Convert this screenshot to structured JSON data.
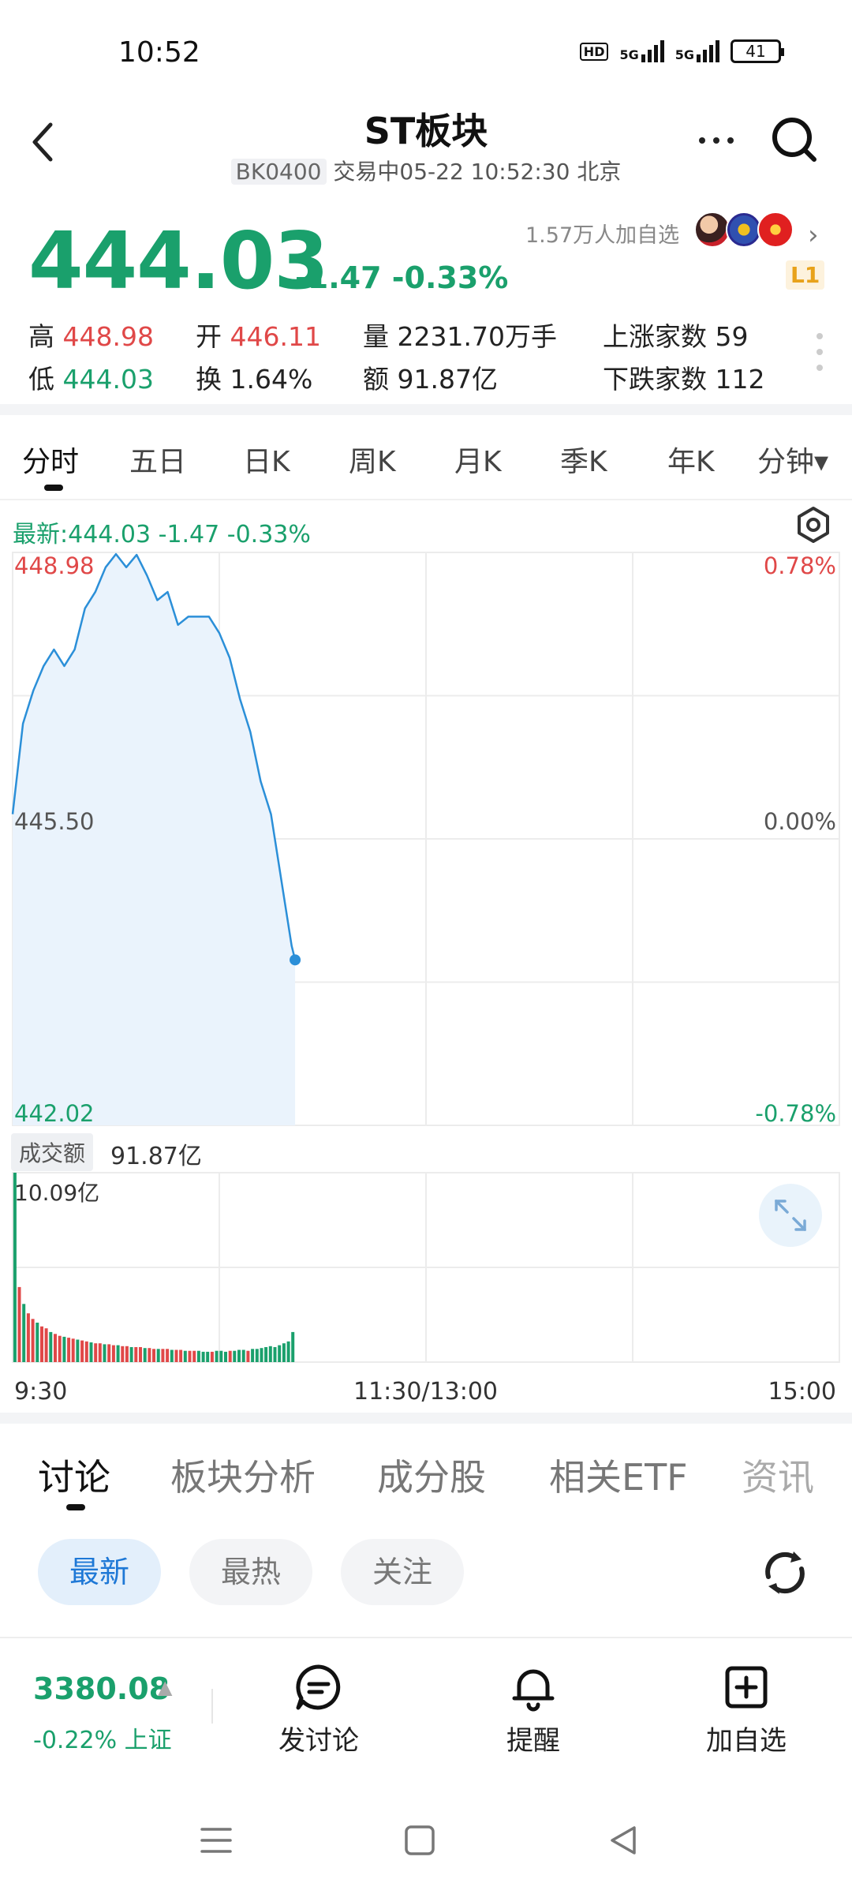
{
  "status": {
    "time": "10:52",
    "battery": "41",
    "hd": "HD",
    "net1": "5G",
    "net2": "5G"
  },
  "header": {
    "title": "ST板块",
    "code": "BK0400",
    "status_text": "交易中05-22 10:52:30 北京"
  },
  "quote": {
    "price": "444.03",
    "change": "-1.47 -0.33%",
    "followers": "1.57万人加自选",
    "level_badge": "L1",
    "stats": {
      "high_label": "高",
      "high": "448.98",
      "open_label": "开",
      "open": "446.11",
      "volume_label": "量",
      "volume": "2231.70万手",
      "up_label": "上涨家数",
      "up": "59",
      "low_label": "低",
      "low": "444.03",
      "turnover_label": "换",
      "turnover": "1.64%",
      "amount_label": "额",
      "amount": "91.87亿",
      "down_label": "下跌家数",
      "down": "112"
    }
  },
  "period_tabs": [
    "分时",
    "五日",
    "日K",
    "周K",
    "月K",
    "季K",
    "年K",
    "分钟▾"
  ],
  "chart": {
    "latest_line": "最新:444.03  -1.47  -0.33%",
    "top_price": "448.98",
    "mid_price": "445.50",
    "bottom_price": "442.02",
    "top_pct": "0.78%",
    "mid_pct": "0.00%",
    "bottom_pct": "-0.78%",
    "amount_label": "成交额",
    "amount_value": "91.87亿",
    "volume_max": "10.09亿",
    "time_start": "9:30",
    "time_mid": "11:30/13:00",
    "time_end": "15:00"
  },
  "chart_data": {
    "type": "line",
    "title": "",
    "xlabel": "",
    "ylabel": "",
    "ylim": [
      442.02,
      448.98
    ],
    "x": [
      "9:30",
      "9:33",
      "9:36",
      "9:39",
      "9:42",
      "9:45",
      "9:48",
      "9:51",
      "9:54",
      "9:57",
      "10:00",
      "10:03",
      "10:06",
      "10:09",
      "10:12",
      "10:15",
      "10:18",
      "10:21",
      "10:24",
      "10:27",
      "10:30",
      "10:33",
      "10:36",
      "10:39",
      "10:42",
      "10:45",
      "10:48",
      "10:51",
      "10:52"
    ],
    "series": [
      {
        "values": [
          445.8,
          446.9,
          447.3,
          447.6,
          447.8,
          447.6,
          447.8,
          448.3,
          448.5,
          448.8,
          448.96,
          448.8,
          448.95,
          448.7,
          448.4,
          448.5,
          448.1,
          448.2,
          448.2,
          448.2,
          448.0,
          447.7,
          447.2,
          446.8,
          446.2,
          445.8,
          445.0,
          444.2,
          444.03
        ]
      }
    ],
    "volume": {
      "ylim": [
        0,
        10.09
      ],
      "values": [
        10.09,
        4.0,
        3.1,
        2.6,
        2.3,
        2.1,
        1.9,
        1.8,
        1.6,
        1.5,
        1.4,
        1.35,
        1.3,
        1.25,
        1.2,
        1.15,
        1.1,
        1.05,
        1.0,
        1.0,
        0.95,
        0.95,
        0.9,
        0.9,
        0.85,
        0.85,
        0.8,
        0.8,
        0.8,
        0.75,
        0.75,
        0.7,
        0.7,
        0.7,
        0.7,
        0.65,
        0.65,
        0.65,
        0.6,
        0.6,
        0.6,
        0.6,
        0.55,
        0.55,
        0.55,
        0.6,
        0.6,
        0.55,
        0.6,
        0.6,
        0.65,
        0.65,
        0.6,
        0.7,
        0.7,
        0.75,
        0.8,
        0.85,
        0.8,
        0.9,
        1.0,
        1.1,
        1.6
      ]
    },
    "colors": {
      "line": "#2b8fd8",
      "fill": "#eaf3fc",
      "up": "#e04848",
      "down": "#1aa06c"
    }
  },
  "bottom_tabs": [
    "讨论",
    "板块分析",
    "成分股",
    "相关ETF",
    "资讯"
  ],
  "filter_pills": [
    "最新",
    "最热",
    "关注"
  ],
  "index": {
    "value": "3380.08",
    "change": "-0.22% 上证"
  },
  "actions": [
    "发讨论",
    "提醒",
    "加自选"
  ]
}
